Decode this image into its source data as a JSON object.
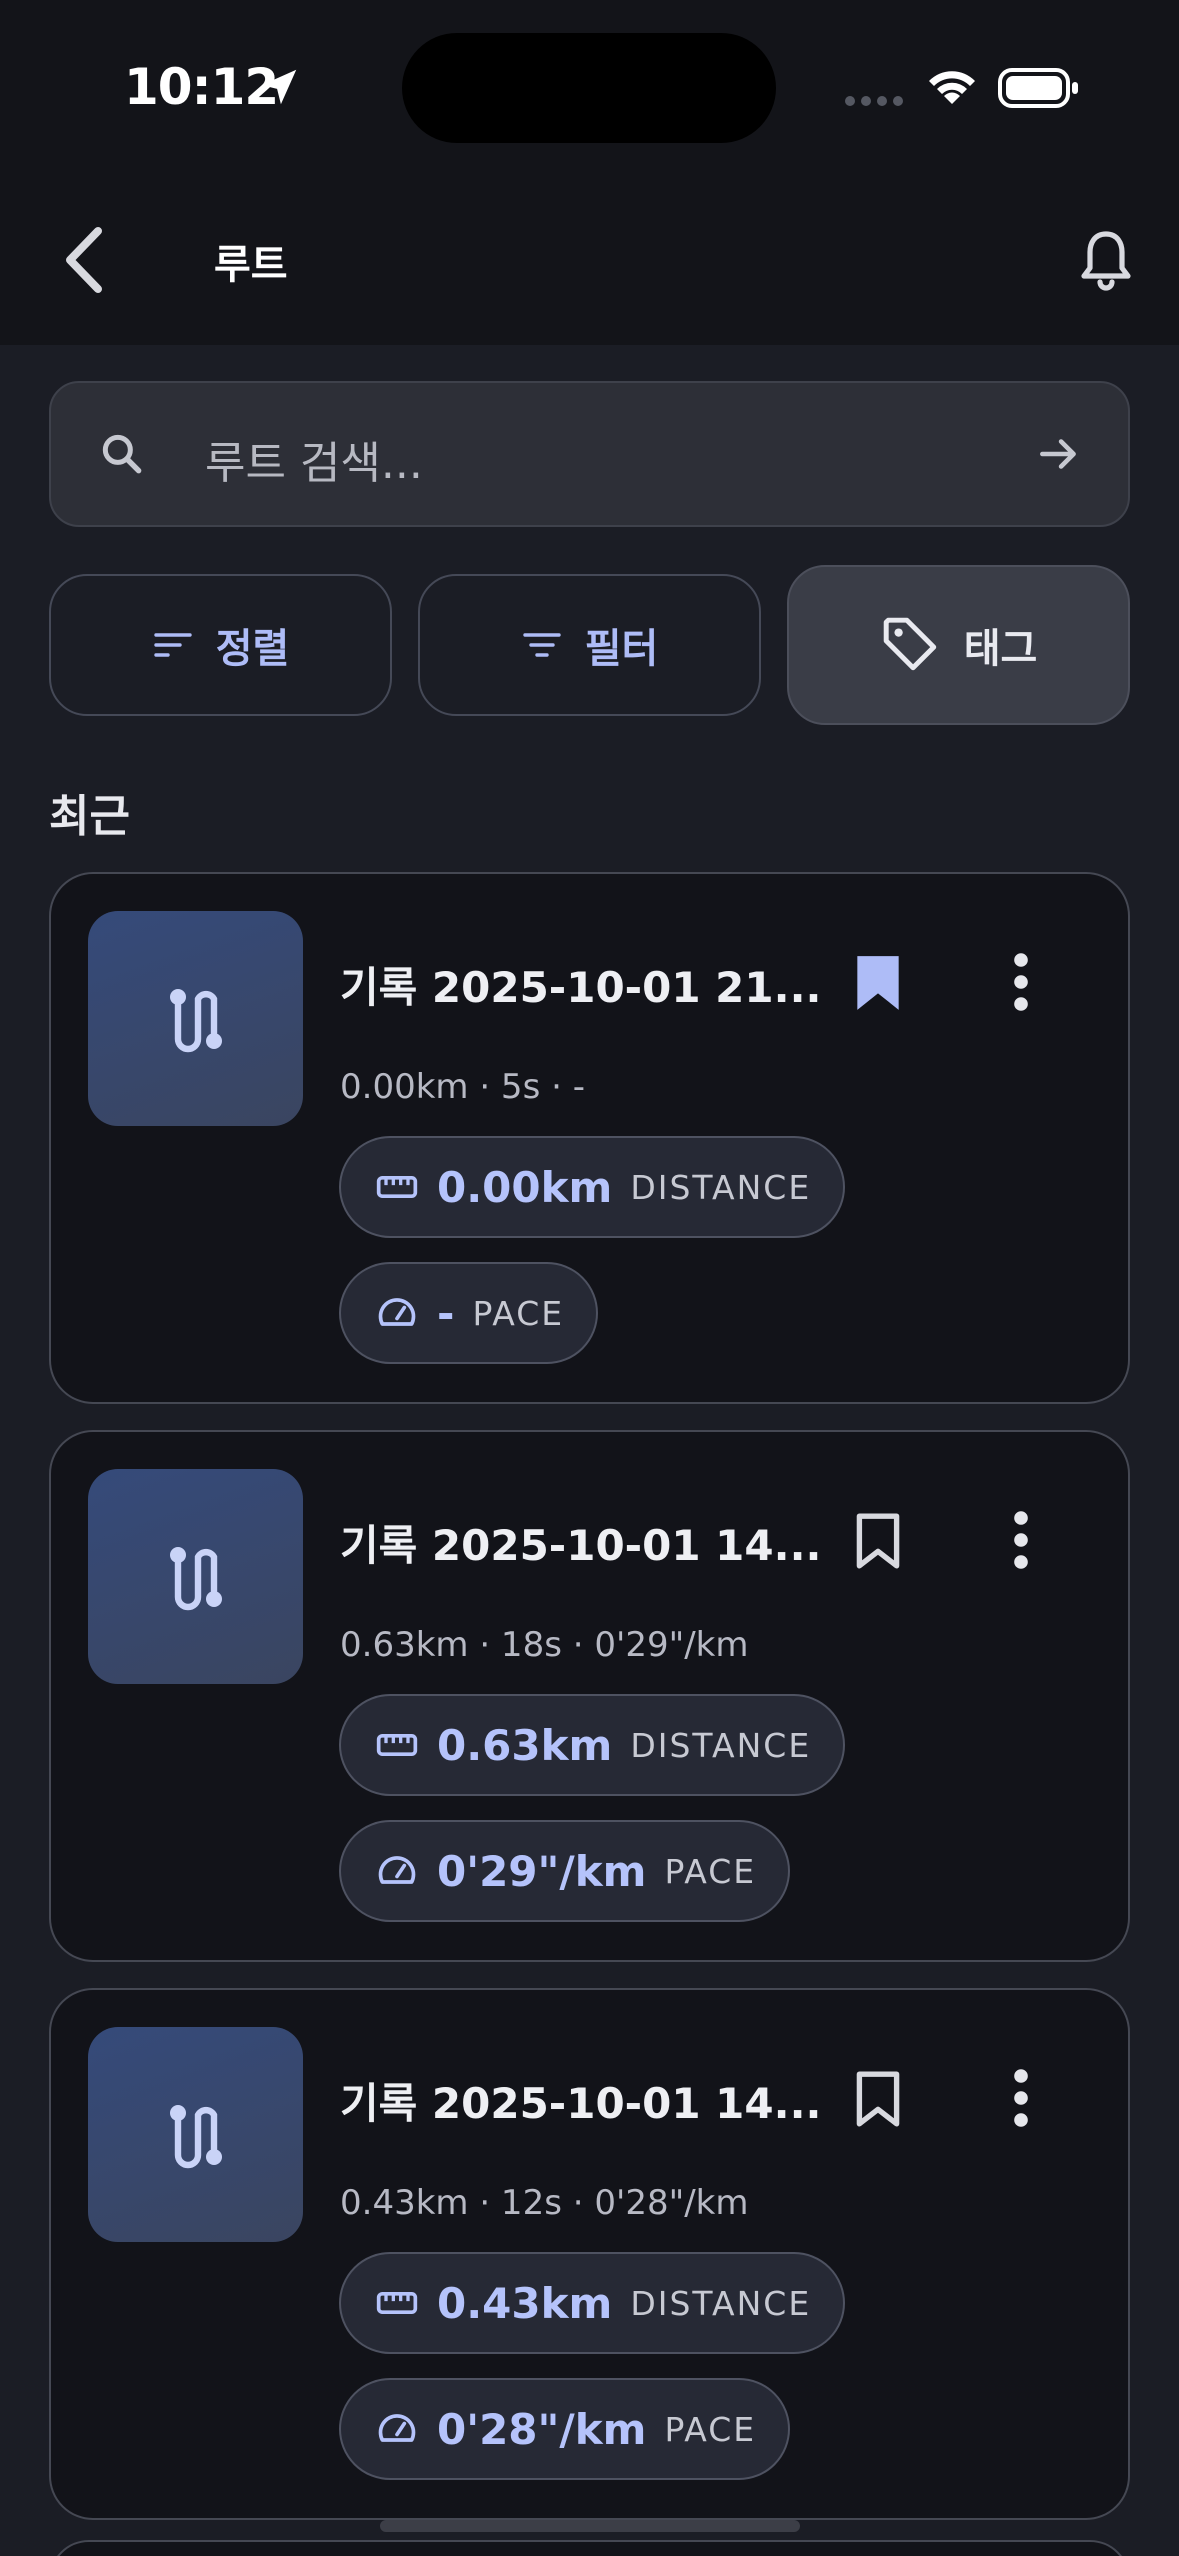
{
  "status_bar": {
    "time": "10:12"
  },
  "header": {
    "title": "루트"
  },
  "search": {
    "placeholder": "루트 검색..."
  },
  "filters": [
    {
      "label": "정렬",
      "icon": "sort-icon"
    },
    {
      "label": "필터",
      "icon": "filter-icon"
    },
    {
      "label": "태그",
      "icon": "tag-icon",
      "active": true
    }
  ],
  "section": {
    "title": "최근"
  },
  "routes": [
    {
      "title": "기록 2025-10-01 21...",
      "summary": "0.00km · 5s · -",
      "distance": "0.00km",
      "distance_label": "DISTANCE",
      "pace": "-",
      "pace_label": "PACE",
      "bookmarked": true
    },
    {
      "title": "기록 2025-10-01 14...",
      "summary": "0.63km · 18s · 0'29\"/km",
      "distance": "0.63km",
      "distance_label": "DISTANCE",
      "pace": "0'29\"/km",
      "pace_label": "PACE",
      "bookmarked": false
    },
    {
      "title": "기록 2025-10-01 14...",
      "summary": "0.43km · 12s · 0'28\"/km",
      "distance": "0.43km",
      "distance_label": "DISTANCE",
      "pace": "0'28\"/km",
      "pace_label": "PACE",
      "bookmarked": false
    }
  ],
  "colors": {
    "accent": "#aebcf7",
    "background": "#1b1d25",
    "card": "#121319",
    "header": "#131419"
  }
}
